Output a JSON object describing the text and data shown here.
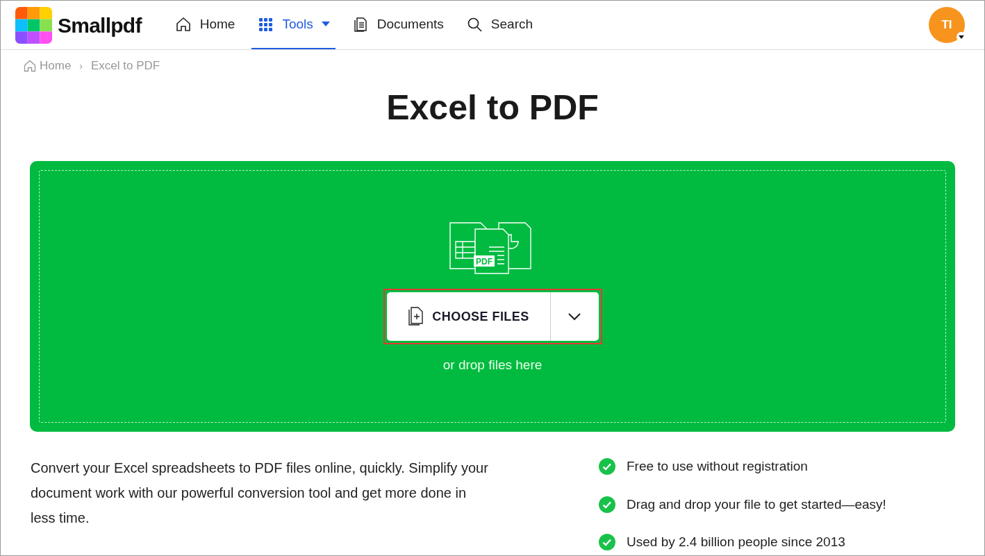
{
  "header": {
    "logo_text": "Smallpdf",
    "nav": [
      {
        "kind": "home",
        "label": "Home",
        "selected": false
      },
      {
        "kind": "tools",
        "label": "Tools",
        "selected": true
      },
      {
        "kind": "documents",
        "label": "Documents",
        "selected": false
      },
      {
        "kind": "search",
        "label": "Search",
        "selected": false
      }
    ],
    "avatar": "TI"
  },
  "breadcrumb": [
    "Home",
    "Excel to PDF"
  ],
  "breadcrumb_separator": "›",
  "title": "Excel to PDF",
  "dropzone": {
    "illustration_label": "PDF",
    "button": "CHOOSE FILES",
    "hint": "or drop files here"
  },
  "description": "Convert your Excel spreadsheets to PDF files online, quickly. Simplify your document work with our powerful conversion tool and get more done in less time.",
  "features": [
    "Free to use without registration",
    "Drag and drop your file to get started—easy!",
    "Used by 2.4 billion people since 2013"
  ]
}
